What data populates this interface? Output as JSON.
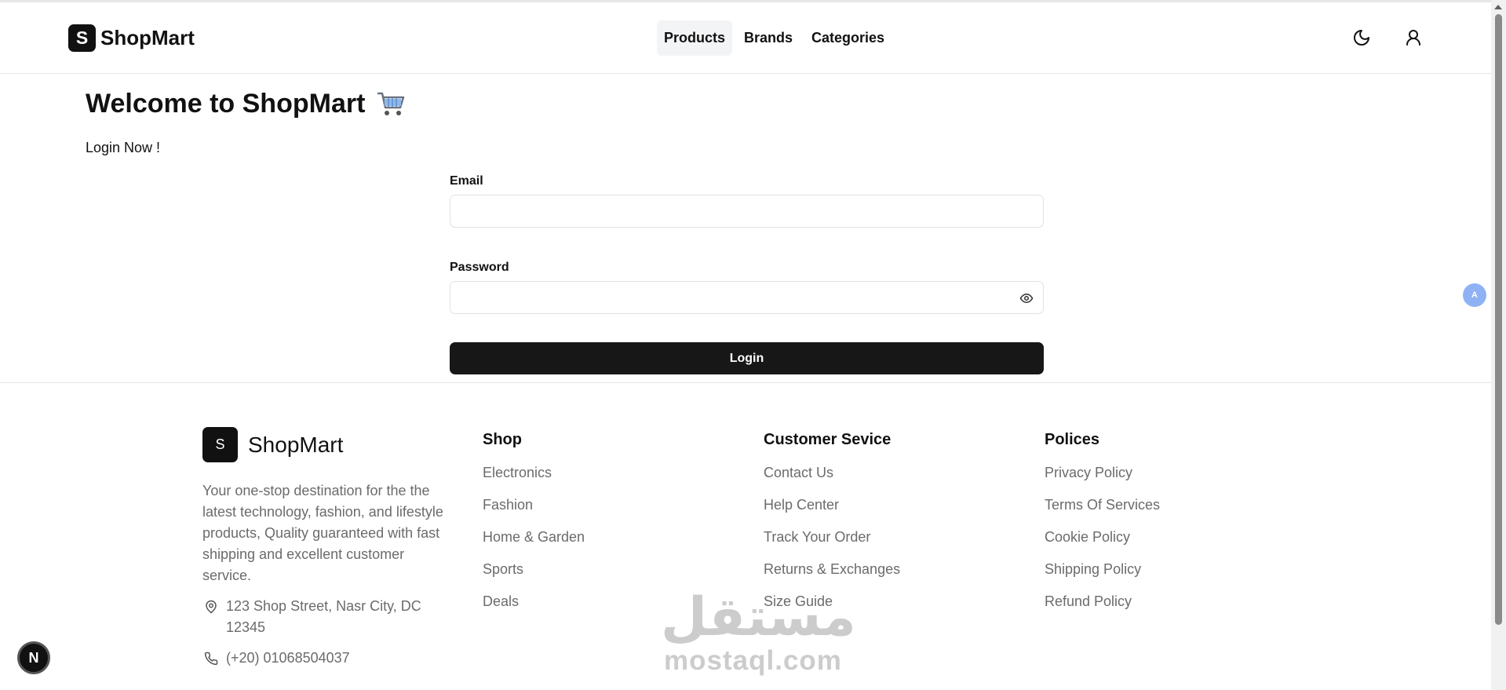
{
  "header": {
    "logo_letter": "S",
    "logo_text": "ShopMart",
    "nav": [
      {
        "label": "Products",
        "active": true
      },
      {
        "label": "Brands",
        "active": false
      },
      {
        "label": "Categories",
        "active": false
      }
    ],
    "icons": [
      "moon-icon",
      "user-icon"
    ]
  },
  "main": {
    "title": "Welcome to ShopMart",
    "title_icon": "shopping-cart-icon",
    "subtitle": "Login Now !",
    "form": {
      "email_label": "Email",
      "email_value": "",
      "password_label": "Password",
      "password_value": "",
      "submit_label": "Login"
    }
  },
  "footer": {
    "logo_letter": "S",
    "logo_text": "ShopMart",
    "description": "Your one-stop destination for the the latest technology, fashion, and lifestyle products, Quality guaranteed with fast shipping and excellent customer service.",
    "address": "123 Shop Street, Nasr City, DC 12345",
    "phone": "(+20) 01068504037",
    "columns": {
      "shop": {
        "title": "Shop",
        "links": [
          "Electronics",
          "Fashion",
          "Home & Garden",
          "Sports",
          "Deals"
        ]
      },
      "service": {
        "title": "Customer Sevice",
        "links": [
          "Contact Us",
          "Help Center",
          "Track Your Order",
          "Returns & Exchanges",
          "Size Guide"
        ]
      },
      "policies": {
        "title": "Polices",
        "links": [
          "Privacy Policy",
          "Terms Of Services",
          "Cookie Policy",
          "Shipping Policy",
          "Refund Policy"
        ]
      }
    }
  },
  "overlays": {
    "watermark_arabic": "مستقل",
    "watermark_latin": "mostaql.com",
    "next_badge": "N",
    "translate_badge": "A"
  },
  "colors": {
    "primary": "#171717",
    "muted_text": "#6b6b6b",
    "border": "#e5e7eb",
    "nav_active_bg": "#f3f4f6",
    "translate_badge": "#8fb2f5"
  }
}
